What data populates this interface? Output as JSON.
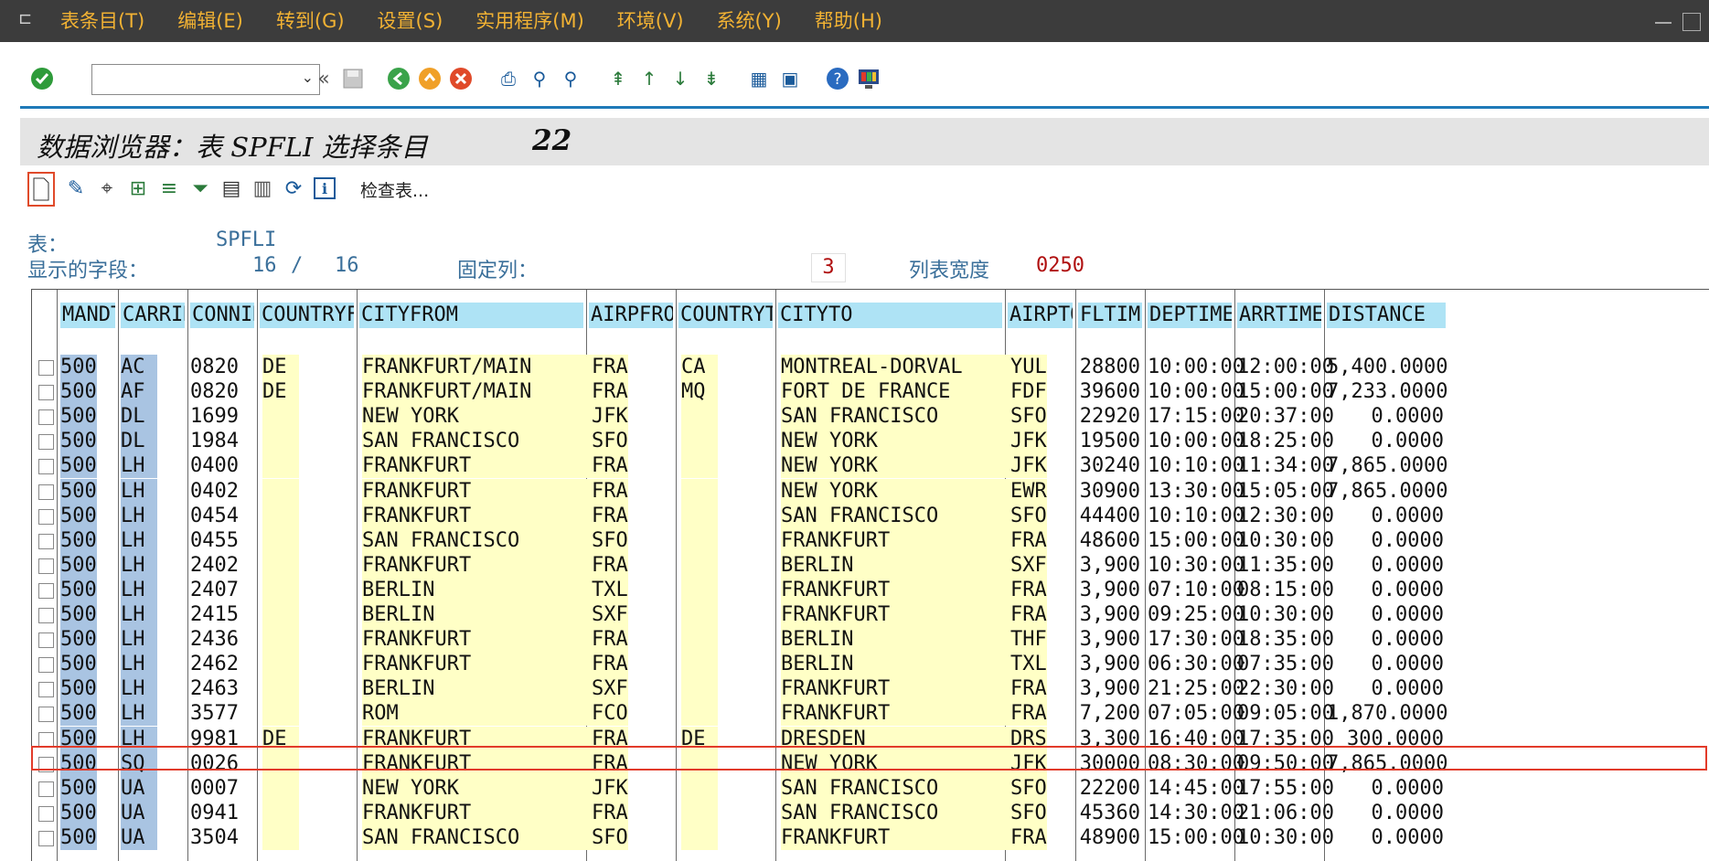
{
  "menu": [
    "表条目(T)",
    "编辑(E)",
    "转到(G)",
    "设置(S)",
    "实用程序(M)",
    "环境(V)",
    "系统(Y)",
    "帮助(H)"
  ],
  "title": {
    "text": "数据浏览器：表 SPFLI 选择条目",
    "count": "22"
  },
  "app_toolbar": {
    "check_tables": "检查表..."
  },
  "info": {
    "table_label": "表：",
    "table_value": "SPFLI",
    "fields_label": "显示的字段：",
    "fields_shown": "16",
    "fields_sep": "/",
    "fields_total": "16",
    "fixed_label": "固定列：",
    "fixed_value": "3",
    "width_label": "列表宽度",
    "width_value": "0250"
  },
  "columns": [
    "MANDT",
    "CARRID",
    "CONNID",
    "COUNTRYFR",
    "CITYFROM",
    "AIRPFROM",
    "COUNTRYTO",
    "CITYTO",
    "AIRPTO",
    "FLTIME",
    "DEPTIME",
    "ARRTIME",
    "DISTANCE"
  ],
  "rows": [
    [
      "500",
      "AC",
      "0820",
      "DE",
      "FRANKFURT/MAIN",
      "FRA",
      "CA",
      "MONTREAL-DORVAL",
      "YUL",
      "28800",
      "10:00:00",
      "12:00:00",
      "5,400.0000"
    ],
    [
      "500",
      "AF",
      "0820",
      "DE",
      "FRANKFURT/MAIN",
      "FRA",
      "MQ",
      "FORT DE FRANCE",
      "FDF",
      "39600",
      "10:00:00",
      "15:00:00",
      "7,233.0000"
    ],
    [
      "500",
      "DL",
      "1699",
      "",
      "NEW YORK",
      "JFK",
      "",
      "SAN FRANCISCO",
      "SFO",
      "22920",
      "17:15:00",
      "20:37:00",
      "0.0000"
    ],
    [
      "500",
      "DL",
      "1984",
      "",
      "SAN FRANCISCO",
      "SFO",
      "",
      "NEW YORK",
      "JFK",
      "19500",
      "10:00:00",
      "18:25:00",
      "0.0000"
    ],
    [
      "500",
      "LH",
      "0400",
      "",
      "FRANKFURT",
      "FRA",
      "",
      "NEW YORK",
      "JFK",
      "30240",
      "10:10:00",
      "11:34:00",
      "7,865.0000"
    ],
    [
      "500",
      "LH",
      "0402",
      "",
      "FRANKFURT",
      "FRA",
      "",
      "NEW YORK",
      "EWR",
      "30900",
      "13:30:00",
      "15:05:00",
      "7,865.0000"
    ],
    [
      "500",
      "LH",
      "0454",
      "",
      "FRANKFURT",
      "FRA",
      "",
      "SAN FRANCISCO",
      "SFO",
      "44400",
      "10:10:00",
      "12:30:00",
      "0.0000"
    ],
    [
      "500",
      "LH",
      "0455",
      "",
      "SAN FRANCISCO",
      "SFO",
      "",
      "FRANKFURT",
      "FRA",
      "48600",
      "15:00:00",
      "10:30:00",
      "0.0000"
    ],
    [
      "500",
      "LH",
      "2402",
      "",
      "FRANKFURT",
      "FRA",
      "",
      "BERLIN",
      "SXF",
      "3,900",
      "10:30:00",
      "11:35:00",
      "0.0000"
    ],
    [
      "500",
      "LH",
      "2407",
      "",
      "BERLIN",
      "TXL",
      "",
      "FRANKFURT",
      "FRA",
      "3,900",
      "07:10:00",
      "08:15:00",
      "0.0000"
    ],
    [
      "500",
      "LH",
      "2415",
      "",
      "BERLIN",
      "SXF",
      "",
      "FRANKFURT",
      "FRA",
      "3,900",
      "09:25:00",
      "10:30:00",
      "0.0000"
    ],
    [
      "500",
      "LH",
      "2436",
      "",
      "FRANKFURT",
      "FRA",
      "",
      "BERLIN",
      "THF",
      "3,900",
      "17:30:00",
      "18:35:00",
      "0.0000"
    ],
    [
      "500",
      "LH",
      "2462",
      "",
      "FRANKFURT",
      "FRA",
      "",
      "BERLIN",
      "TXL",
      "3,900",
      "06:30:00",
      "07:35:00",
      "0.0000"
    ],
    [
      "500",
      "LH",
      "2463",
      "",
      "BERLIN",
      "SXF",
      "",
      "FRANKFURT",
      "FRA",
      "3,900",
      "21:25:00",
      "22:30:00",
      "0.0000"
    ],
    [
      "500",
      "LH",
      "3577",
      "",
      "ROM",
      "FCO",
      "",
      "FRANKFURT",
      "FRA",
      "7,200",
      "07:05:00",
      "09:05:00",
      "1,870.0000"
    ],
    [
      "500",
      "LH",
      "9981",
      "DE",
      "FRANKFURT",
      "FRA",
      "DE",
      "DRESDEN",
      "DRS",
      "3,300",
      "16:40:00",
      "17:35:00",
      "300.0000"
    ],
    [
      "500",
      "SQ",
      "0026",
      "",
      "FRANKFURT",
      "FRA",
      "",
      "NEW YORK",
      "JFK",
      "30000",
      "08:30:00",
      "09:50:00",
      "7,865.0000"
    ],
    [
      "500",
      "UA",
      "0007",
      "",
      "NEW YORK",
      "JFK",
      "",
      "SAN FRANCISCO",
      "SFO",
      "22200",
      "14:45:00",
      "17:55:00",
      "0.0000"
    ],
    [
      "500",
      "UA",
      "0941",
      "",
      "FRANKFURT",
      "FRA",
      "",
      "SAN FRANCISCO",
      "SFO",
      "45360",
      "14:30:00",
      "21:06:00",
      "0.0000"
    ],
    [
      "500",
      "UA",
      "3504",
      "",
      "SAN FRANCISCO",
      "SFO",
      "",
      "FRANKFURT",
      "FRA",
      "48900",
      "15:00:00",
      "10:30:00",
      "0.0000"
    ]
  ],
  "colors": {
    "key": "#a9c4e2",
    "field": "#ffffc6",
    "header": "#aee3f5",
    "highlight": "#e23b2a",
    "accent": "#1f7ab8",
    "menu_text": "#f2b233"
  },
  "icons": [
    "check-icon",
    "back-icon",
    "save-icon",
    "green-back-icon",
    "orange-exit-icon",
    "red-cancel-icon",
    "print-icon",
    "find-icon",
    "find-next-icon",
    "first-page-icon",
    "prev-page-icon",
    "next-page-icon",
    "last-page-icon",
    "layout-icon",
    "window-icon",
    "help-icon",
    "customize-icon"
  ]
}
